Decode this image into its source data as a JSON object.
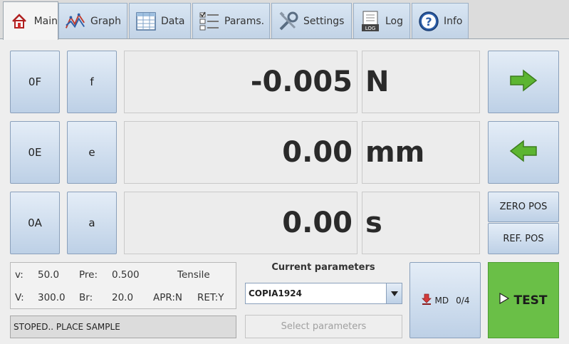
{
  "tabs": [
    {
      "label": "Main",
      "icon": "home-icon",
      "active": true
    },
    {
      "label": "Graph",
      "icon": "graph-icon"
    },
    {
      "label": "Data",
      "icon": "table-icon"
    },
    {
      "label": "Params.",
      "icon": "checklist-icon"
    },
    {
      "label": "Settings",
      "icon": "tools-icon"
    },
    {
      "label": "Log",
      "icon": "log-icon",
      "badge": "LOG"
    },
    {
      "label": "Info",
      "icon": "help-icon"
    }
  ],
  "zero_buttons": [
    "0F",
    "0E",
    "0A"
  ],
  "letter_buttons": [
    "f",
    "e",
    "a"
  ],
  "readings": [
    {
      "value": "-0.005",
      "unit": "N"
    },
    {
      "value": "0.00",
      "unit": "mm"
    },
    {
      "value": "0.00",
      "unit": "s"
    }
  ],
  "position_buttons": {
    "zero_pos": "ZERO POS",
    "ref_pos": "REF. POS"
  },
  "info": {
    "v_label": "v:",
    "v_value": "50.0",
    "pre_label": "Pre:",
    "pre_value": "0.500",
    "mode": "Tensile",
    "V_label": "V:",
    "V_value": "300.0",
    "br_label": "Br:",
    "br_value": "20.0",
    "apr": "APR:N",
    "ret": "RET:Y"
  },
  "status": "STOPED.. PLACE SAMPLE",
  "current_parameters": {
    "label": "Current parameters",
    "selected": "COPIA1924"
  },
  "select_parameters": "Select parameters",
  "md": {
    "label": "MD",
    "count": "0/4"
  },
  "test": "TEST",
  "colors": {
    "test_green": "#6abf47",
    "arrow_green": "#5cb531",
    "tab_blue": "#c2d3e6"
  }
}
